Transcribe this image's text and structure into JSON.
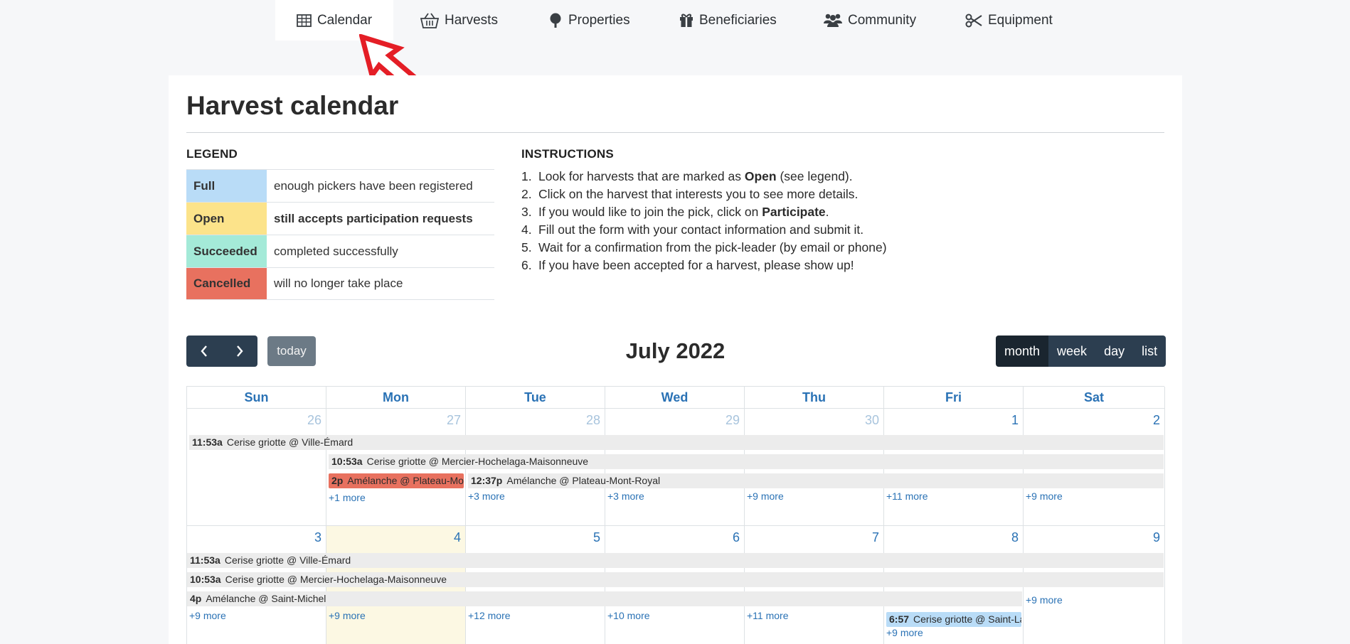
{
  "nav": {
    "items": [
      {
        "label": "Calendar",
        "icon": "table-icon"
      },
      {
        "label": "Harvests",
        "icon": "basket-icon"
      },
      {
        "label": "Properties",
        "icon": "tree-icon"
      },
      {
        "label": "Beneficiaries",
        "icon": "gift-icon"
      },
      {
        "label": "Community",
        "icon": "users-icon"
      },
      {
        "label": "Equipment",
        "icon": "scissors-icon"
      }
    ],
    "active": "Calendar"
  },
  "page": {
    "title": "Harvest calendar"
  },
  "legend": {
    "heading": "LEGEND",
    "rows": [
      {
        "key": "Full",
        "desc": "enough pickers have been registered",
        "color": "#b9dcf7"
      },
      {
        "key": "Open",
        "desc": "still accepts participation requests",
        "color": "#fce38a"
      },
      {
        "key": "Succeeded",
        "desc": "completed successfully",
        "color": "#a4ead8"
      },
      {
        "key": "Cancelled",
        "desc": "will no longer take place",
        "color": "#e8715f"
      }
    ]
  },
  "instructions": {
    "heading": "INSTRUCTIONS",
    "steps": [
      {
        "num": "1.",
        "pre": "Look for harvests that are marked as ",
        "bold": "Open",
        "post": " (see legend)."
      },
      {
        "num": "2.",
        "pre": "Click on the harvest that interests you to see more details.",
        "bold": "",
        "post": ""
      },
      {
        "num": "3.",
        "pre": "If you would like to join the pick, click on ",
        "bold": "Participate",
        "post": "."
      },
      {
        "num": "4.",
        "pre": "Fill out the form with your contact information and submit it.",
        "bold": "",
        "post": ""
      },
      {
        "num": "5.",
        "pre": "Wait for a confirmation from the pick-leader (by email or phone)",
        "bold": "",
        "post": ""
      },
      {
        "num": "6.",
        "pre": "If you have been accepted for a harvest, please show up!",
        "bold": "",
        "post": ""
      }
    ]
  },
  "toolbar": {
    "prev_icon": "chevron-left-icon",
    "next_icon": "chevron-right-icon",
    "today": "today",
    "title": "July 2022",
    "views": [
      "month",
      "week",
      "day",
      "list"
    ],
    "active_view": "month"
  },
  "calendar": {
    "days": [
      "Sun",
      "Mon",
      "Tue",
      "Wed",
      "Thu",
      "Fri",
      "Sat"
    ],
    "weeks": [
      {
        "dates": [
          {
            "n": "26",
            "other": true
          },
          {
            "n": "27",
            "other": true
          },
          {
            "n": "28",
            "other": true
          },
          {
            "n": "29",
            "other": true
          },
          {
            "n": "30",
            "other": true
          },
          {
            "n": "1",
            "other": false
          },
          {
            "n": "2",
            "other": false
          }
        ],
        "events": [
          {
            "time": "11:53a",
            "title": "Cerise griotte @ Ville-Émard",
            "status": "default"
          },
          {
            "time": "10:53a",
            "title": "Cerise griotte @ Mercier-Hochelaga-Maisonneuve",
            "status": "default"
          },
          {
            "time": "2p",
            "title": "Amélanche @ Plateau-Mont-Royal",
            "status": "cancelled"
          },
          {
            "time": "12:37p",
            "title": "Amélanche @ Plateau-Mont-Royal",
            "status": "default"
          }
        ],
        "more": [
          "",
          "+1 more",
          "+3 more",
          "+3 more",
          "+9 more",
          "+11 more",
          "+9 more"
        ]
      },
      {
        "dates": [
          {
            "n": "3",
            "other": false
          },
          {
            "n": "4",
            "other": false,
            "today": true
          },
          {
            "n": "5",
            "other": false
          },
          {
            "n": "6",
            "other": false
          },
          {
            "n": "7",
            "other": false
          },
          {
            "n": "8",
            "other": false
          },
          {
            "n": "9",
            "other": false
          }
        ],
        "events": [
          {
            "time": "11:53a",
            "title": "Cerise griotte @ Ville-Émard",
            "status": "default"
          },
          {
            "time": "10:53a",
            "title": "Cerise griotte @ Mercier-Hochelaga-Maisonneuve",
            "status": "default"
          },
          {
            "time": "4p",
            "title": "Amélanche @ Saint-Michel",
            "status": "default"
          },
          {
            "time": "6:57",
            "title": "Cerise griotte @ Saint-Laurent",
            "status": "full"
          }
        ],
        "more": [
          "+9 more",
          "+9 more",
          "+12 more",
          "+10 more",
          "+11 more",
          "+9 more",
          "+9 more"
        ]
      }
    ]
  }
}
